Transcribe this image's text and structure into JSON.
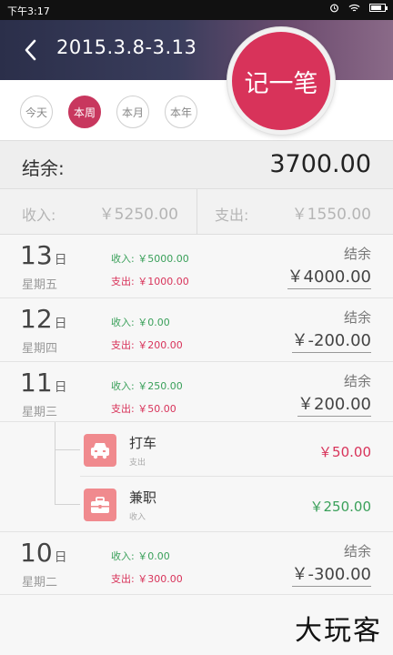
{
  "status_bar": {
    "time": "下午3:17"
  },
  "header": {
    "title": "2015.3.8-3.13"
  },
  "record_button": {
    "label": "记一笔"
  },
  "tabs": [
    {
      "label": "今天"
    },
    {
      "label": "本周",
      "active": true
    },
    {
      "label": "本月"
    },
    {
      "label": "本年"
    }
  ],
  "balance": {
    "label": "结余:",
    "value": "3700.00"
  },
  "summary": {
    "income_label": "收入:",
    "income_value": "￥5250.00",
    "expense_label": "支出:",
    "expense_value": "￥1550.00"
  },
  "days": [
    {
      "day": "13",
      "unit": "日",
      "weekday": "星期五",
      "income": "收入: ￥5000.00",
      "expense": "支出: ￥1000.00",
      "balance_label": "结余",
      "balance_value": "￥4000.00"
    },
    {
      "day": "12",
      "unit": "日",
      "weekday": "星期四",
      "income": "收入: ￥0.00",
      "expense": "支出: ￥200.00",
      "balance_label": "结余",
      "balance_value": "￥-200.00"
    },
    {
      "day": "11",
      "unit": "日",
      "weekday": "星期三",
      "income": "收入: ￥250.00",
      "expense": "支出: ￥50.00",
      "balance_label": "结余",
      "balance_value": "￥200.00"
    },
    {
      "day": "10",
      "unit": "日",
      "weekday": "星期二",
      "income": "收入: ￥0.00",
      "expense": "支出: ￥300.00",
      "balance_label": "结余",
      "balance_value": "￥-300.00"
    }
  ],
  "entries": [
    {
      "name": "打车",
      "type": "支出",
      "amount": "￥50.00",
      "icon": "car-icon",
      "color": "#d8335a"
    },
    {
      "name": "兼职",
      "type": "收入",
      "amount": "￥250.00",
      "icon": "briefcase-icon",
      "color": "#3aa05a"
    }
  ],
  "watermark": "大玩客",
  "colors": {
    "accent": "#d8335a",
    "income": "#3aa05a",
    "expense": "#d8335a",
    "icon_bg": "#f08a8e"
  }
}
